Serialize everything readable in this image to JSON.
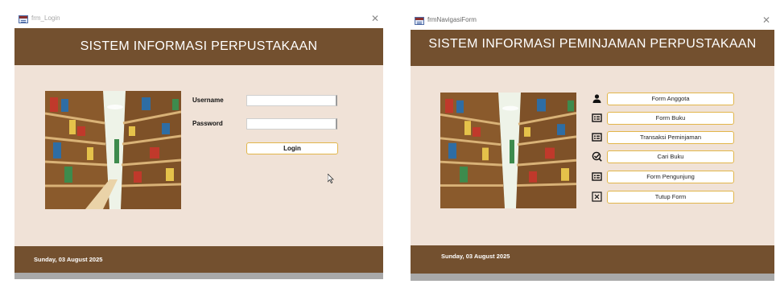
{
  "login_window": {
    "title": "frm_Login",
    "header_title": "SISTEM INFORMASI PERPUSTAKAAN",
    "username_label": "Username",
    "username_value": "",
    "password_label": "Password",
    "password_value": "",
    "login_button": "Login",
    "footer_date": "Sunday, 03 August 2025"
  },
  "nav_window": {
    "title": "frmNavigasiForm",
    "header_title": "SISTEM INFORMASI PEMINJAMAN PERPUSTAKAAN",
    "buttons": [
      {
        "label": "Form Anggota",
        "icon": "person-icon"
      },
      {
        "label": "Form Buku",
        "icon": "form-icon"
      },
      {
        "label": "Transaksi Peminjaman",
        "icon": "form-icon"
      },
      {
        "label": "Cari Buku",
        "icon": "search-check-icon"
      },
      {
        "label": "Form Pengunjung",
        "icon": "form-icon"
      },
      {
        "label": "Tutup Form",
        "icon": "close-box-icon"
      }
    ],
    "footer_date": "Sunday, 03 August 2025"
  },
  "colors": {
    "header_brown": "#73502f",
    "body_beige": "#f0e2d7",
    "button_border": "#e2b64a"
  }
}
